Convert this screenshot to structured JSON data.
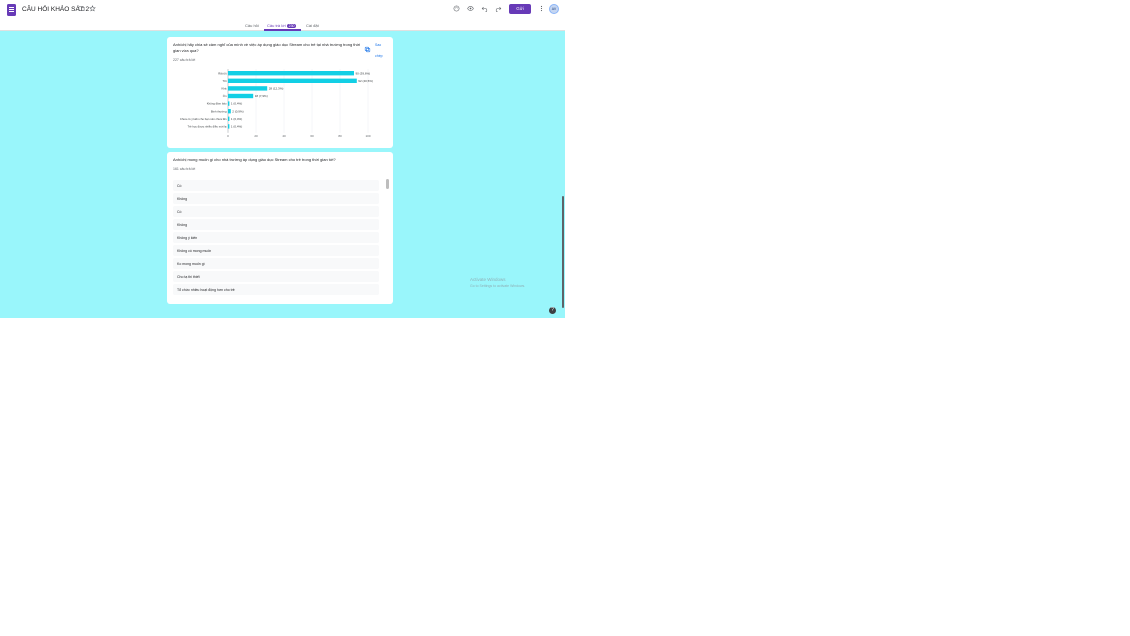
{
  "header": {
    "title": "CÂU HỎI KHẢO SÁT 2",
    "send_label": "Gửi",
    "avatar_text": "AV",
    "icons": [
      "folder-icon",
      "star-icon",
      "palette-icon",
      "eye-icon",
      "undo-icon",
      "redo-icon",
      "more-vert-icon"
    ]
  },
  "tabs": [
    {
      "label": "Câu hỏi"
    },
    {
      "label": "Câu trả lời",
      "badge": "230"
    },
    {
      "label": "Cài đặt"
    }
  ],
  "question1": {
    "text": "Anh/chị hãy chia sẻ cảm nghĩ của mình về việc áp dụng giáo dục Stream cho trẻ tại nhà trường trong thời gian vừa qua?",
    "count": "227 câu trả lời",
    "copy_label_1": "Sao",
    "copy_label_2": "chép"
  },
  "chart_data": {
    "type": "bar",
    "orientation": "horizontal",
    "categories": [
      "Rất tốt",
      "Tốt",
      "Khá",
      "Ổn",
      "Không đảm bảo",
      "Bình thường",
      "Chưa có ý kiến cho bạn nên chưa lần",
      "Trẻ học được nhiều điều mới lạ"
    ],
    "values": [
      90,
      92,
      28,
      18,
      1,
      2,
      1,
      1
    ],
    "labels": [
      "90 (39,6%)",
      "92 (40,5%)",
      "28 (12,3%)",
      "18 (7,9%)",
      "1 (0,4%)",
      "2 (0,9%)",
      "1 (0,4%)",
      "1 (0,4%)"
    ],
    "xticks": [
      "0",
      "20",
      "40",
      "60",
      "80",
      "100"
    ],
    "xlim": [
      0,
      100
    ],
    "grid": true,
    "bar_color": "#12cfe5"
  },
  "question2": {
    "text": "Anh/chị mong muốn gì cho nhà trường áp dụng giáo dục Stream cho trẻ trong thời gian tới?",
    "count": "161 câu trả lời",
    "responses": [
      "Có",
      "Không",
      "Có",
      "Không",
      "Không ý kiến",
      "Không có mong muốn",
      "Ko mong muốn gì",
      "Cho tạ thi thiết",
      "Tổ chức nhiều hoạt động hơn cho trẻ"
    ]
  },
  "watermark": {
    "line1": "Activate Windows",
    "line2": "Go to Settings to activate Windows."
  },
  "help_label": "?"
}
